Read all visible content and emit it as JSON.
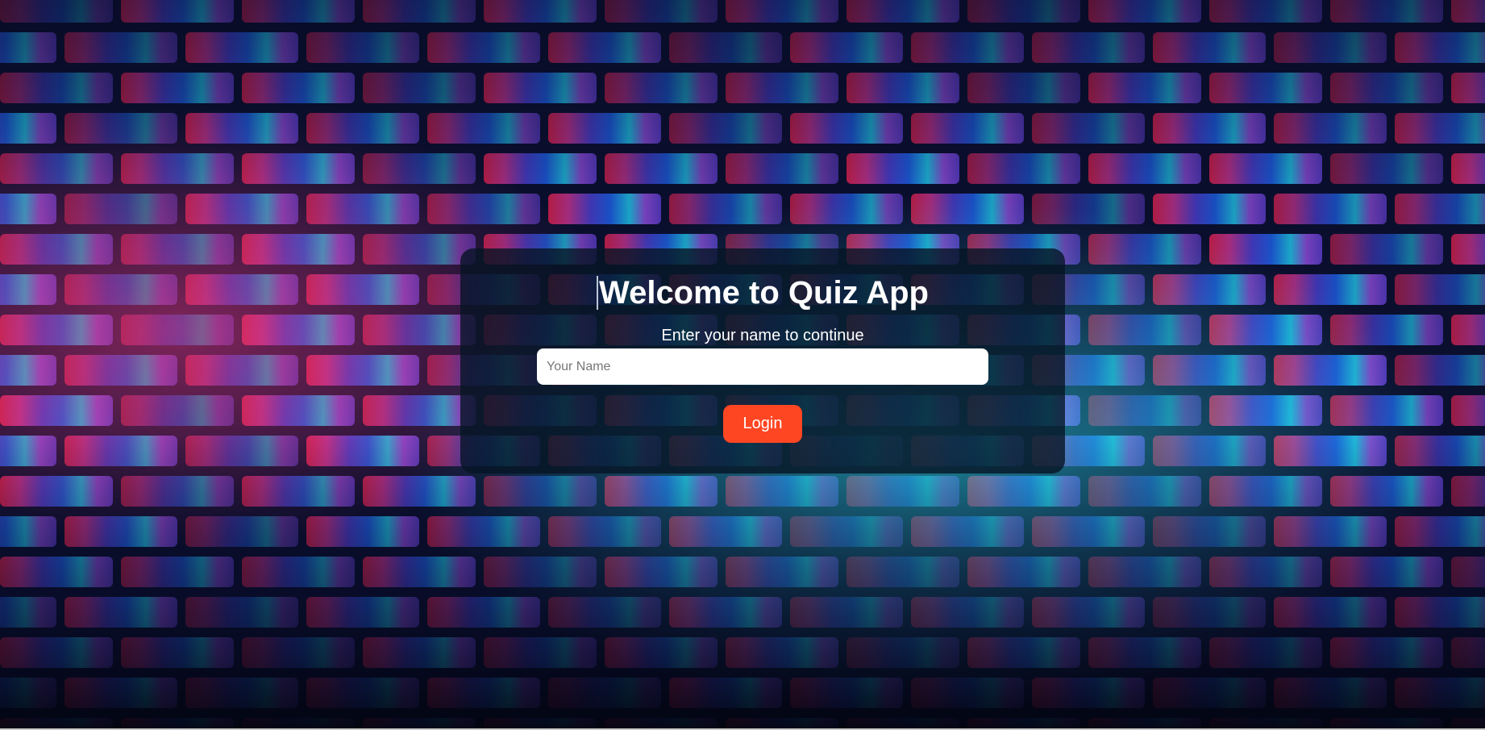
{
  "login": {
    "title": "Welcome to Quiz App",
    "subtitle": "Enter your name to continue",
    "name_input": {
      "placeholder": "Your Name",
      "value": ""
    },
    "login_label": "Login"
  },
  "colors": {
    "card_background": "#061424",
    "button_accent": "#ff4622",
    "text": "#ffffff"
  }
}
